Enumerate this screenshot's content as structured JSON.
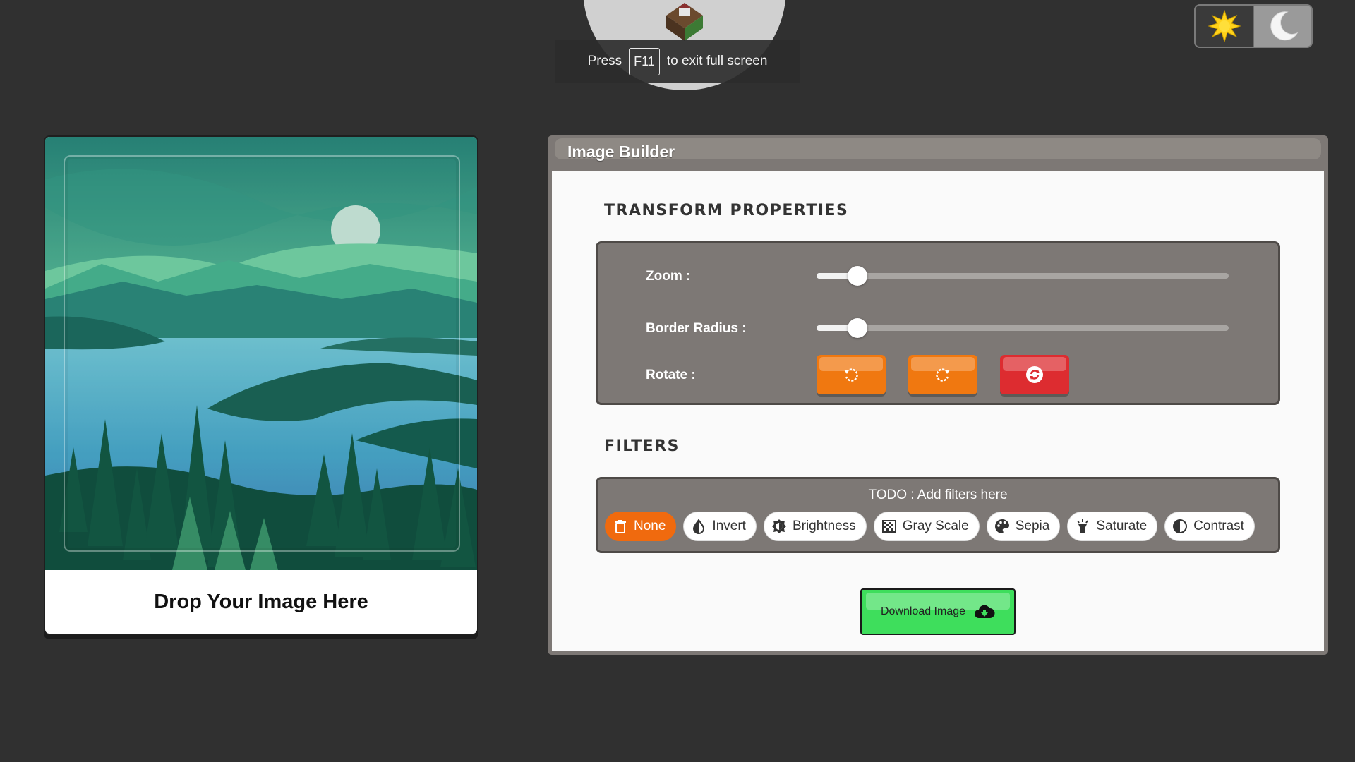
{
  "fullscreen_notice": {
    "press": "Press",
    "key": "F11",
    "suffix": "to exit full screen"
  },
  "theme_toggle": {
    "light_icon": "sun-icon",
    "dark_icon": "moon-icon"
  },
  "image_card": {
    "drop_label": "Drop Your Image Here"
  },
  "builder": {
    "title": "Image Builder",
    "transform_title": "TRANSFORM PROPERTIES",
    "zoom_label": "Zoom :",
    "zoom_value": 0.1,
    "radius_label": "Border Radius :",
    "radius_value": 0.1,
    "rotate_label": "Rotate :",
    "rotate_buttons": [
      {
        "name": "rotate-left-button",
        "icon": "rotate-left-icon",
        "color": "#f07810"
      },
      {
        "name": "rotate-right-button",
        "icon": "rotate-right-icon",
        "color": "#f07810"
      },
      {
        "name": "reset-rotation-button",
        "icon": "reset-icon",
        "color": "#dd2c30"
      }
    ],
    "filters_title": "FILTERS",
    "filters_note": "TODO : Add filters here",
    "filters": [
      {
        "label": "None",
        "icon": "trash-icon",
        "active": true
      },
      {
        "label": "Invert",
        "icon": "invert-icon",
        "active": false
      },
      {
        "label": "Brightness",
        "icon": "brightness-icon",
        "active": false
      },
      {
        "label": "Gray Scale",
        "icon": "grayscale-icon",
        "active": false
      },
      {
        "label": "Sepia",
        "icon": "palette-icon",
        "active": false
      },
      {
        "label": "Saturate",
        "icon": "saturate-icon",
        "active": false
      },
      {
        "label": "Contrast",
        "icon": "contrast-icon",
        "active": false
      }
    ],
    "download_label": "Download Image",
    "download_icon": "cloud-download-icon"
  },
  "colors": {
    "accent_orange": "#f07810",
    "danger_red": "#dd2c30",
    "download_green": "#3ede5c",
    "panel_grey": "#7d7875"
  }
}
